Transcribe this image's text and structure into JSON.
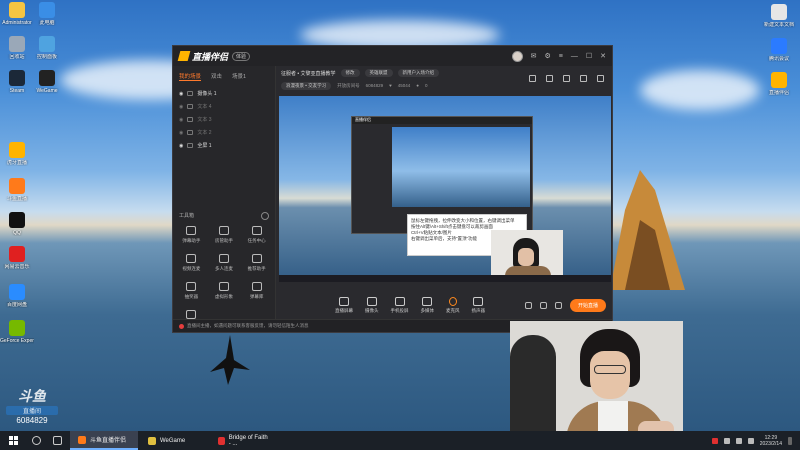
{
  "desktop": {
    "icons": [
      {
        "label": "Administrator",
        "color": "#f5c542"
      },
      {
        "label": "此电脑",
        "color": "#3a8ee6"
      },
      {
        "label": "回收站",
        "color": "#9aa8b8"
      },
      {
        "label": "控制面板",
        "color": "#4fa3e0"
      },
      {
        "label": "Steam",
        "color": "#1b2838"
      },
      {
        "label": "WeGame",
        "color": "#222"
      },
      {
        "label": "虎牙直播",
        "color": "#ffb400"
      },
      {
        "label": "斗鱼直播",
        "color": "#ff7a1a"
      },
      {
        "label": "QQ",
        "color": "#111"
      },
      {
        "label": "网易云音乐",
        "color": "#e02020"
      },
      {
        "label": "百度网盘",
        "color": "#2a8cff"
      },
      {
        "label": "GeForce Experience",
        "color": "#76b900"
      }
    ],
    "icons_right": [
      {
        "label": "新建文本文档",
        "color": "#e6e6e6"
      },
      {
        "label": "腾讯会议",
        "color": "#2b7bff"
      },
      {
        "label": "直播伴侣",
        "color": "#ffb400"
      }
    ]
  },
  "app": {
    "title": "直播伴侣",
    "badge": "体验",
    "sidebar": {
      "tabs": [
        "我的场景",
        "双击",
        "场景1"
      ],
      "scenes": [
        {
          "label": "摄像头 1",
          "active": true
        },
        {
          "label": "文本 4",
          "active": false
        },
        {
          "label": "文本 3",
          "active": false
        },
        {
          "label": "文本 2",
          "active": false
        },
        {
          "label": "全屏 1",
          "active": true
        }
      ],
      "toolbox_title": "工具箱",
      "tools": [
        "弹幕助手",
        "房管助手",
        "任务中心",
        "视频连麦",
        "多人连麦",
        "推荐助手",
        "抽奖器",
        "虚拟形象",
        "弹幕库",
        "更多"
      ]
    },
    "info": {
      "room_title": "征服者 • 艾黎亚直播教学",
      "edit_label": "修改",
      "category": "英雄联盟",
      "hint": "新用户入场介绍",
      "tag": "浪漫夜景 • 交友学习",
      "room_id_label": "开放房间号",
      "room_id": "6084829",
      "fans": "45044",
      "hot": "0"
    },
    "preview": {
      "inner_title": "直播伴侣",
      "tooltip_lines": [
        "鼠标左键拖拽，拉伸改变大小和位置，右键调出菜单",
        "按住Alt键/Alt+Shift点击键盘可以裁剪画面",
        "Ctrl+V粘贴文本/图片",
        "右键调出菜单后，支持“置顶”功能"
      ]
    },
    "controls": [
      {
        "label": "直播屏幕",
        "icon": "screen-icon"
      },
      {
        "label": "摄像头",
        "icon": "camera-icon"
      },
      {
        "label": "手机投屏",
        "icon": "phone-cast-icon"
      },
      {
        "label": "多媒体",
        "icon": "media-icon"
      },
      {
        "label": "麦克风",
        "icon": "mic-icon"
      },
      {
        "label": "扬声器",
        "icon": "speaker-icon"
      }
    ],
    "start_button": "开始直播",
    "notice": "直播间主播，如遇问题可联系客服反馈，请勿轻信陌生人消息"
  },
  "watermark": {
    "logo": "斗鱼",
    "sub": "直播间",
    "room_id": "6084829"
  },
  "taskbar": {
    "apps": [
      {
        "label": "斗鱼直播伴侣",
        "color": "#ff7a1a",
        "active": true
      },
      {
        "label": "WeGame",
        "color": "#e0c040",
        "active": false
      },
      {
        "label": "Bridge of Faith - ...",
        "color": "#e03030",
        "active": false
      }
    ],
    "time": "12:29",
    "date": "2023/2/14"
  }
}
